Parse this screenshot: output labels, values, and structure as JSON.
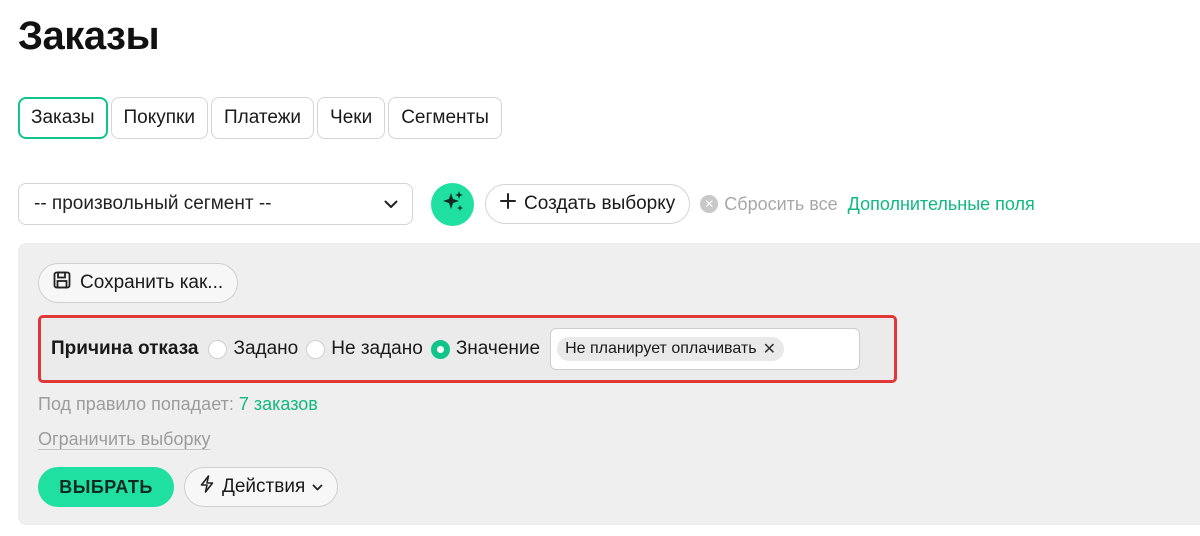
{
  "page": {
    "title": "Заказы"
  },
  "tabs": [
    {
      "label": "Заказы",
      "active": true
    },
    {
      "label": "Покупки",
      "active": false
    },
    {
      "label": "Платежи",
      "active": false
    },
    {
      "label": "Чеки",
      "active": false
    },
    {
      "label": "Сегменты",
      "active": false
    }
  ],
  "toolbar": {
    "segment_select_value": "-- произвольный сегмент --",
    "ai_icon": "sparkles-icon",
    "create_label": "Создать выборку",
    "reset_label": "Сбросить все",
    "extra_fields_label": "Дополнительные поля"
  },
  "panel": {
    "save_as_label": "Сохранить как...",
    "rule": {
      "label": "Причина отказа",
      "options": [
        {
          "label": "Задано",
          "checked": false
        },
        {
          "label": "Не задано",
          "checked": false
        },
        {
          "label": "Значение",
          "checked": true
        }
      ],
      "value_tag": "Не планирует оплачивать"
    },
    "match_prefix": "Под правило попадает:",
    "match_count": "7 заказов",
    "limit_label": "Ограничить выборку",
    "select_label": "ВЫБРАТЬ",
    "actions_label": "Действия"
  },
  "colors": {
    "accent": "#1fe0a0",
    "accent_text": "#12b881",
    "highlight_border": "#e03838",
    "panel_bg": "#efefef"
  }
}
